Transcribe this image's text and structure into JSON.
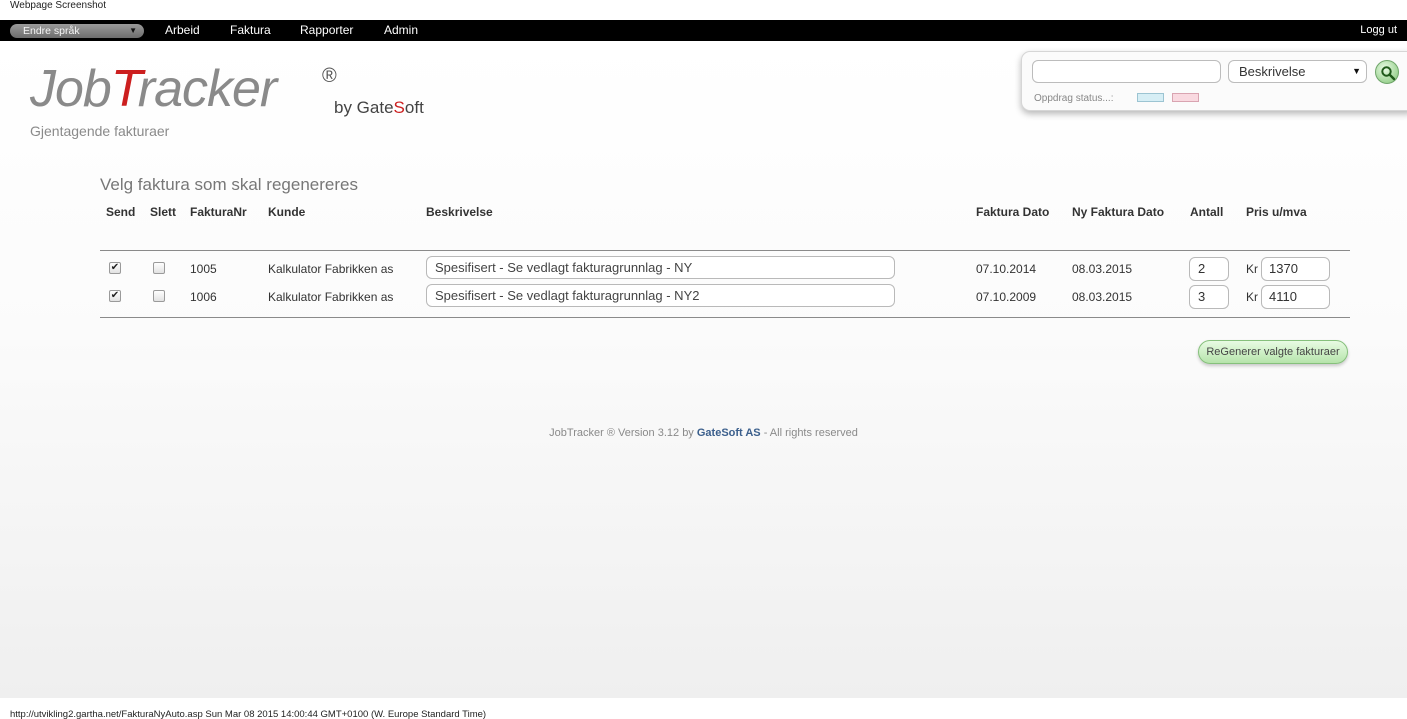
{
  "browser": {
    "caption_top": "Webpage Screenshot",
    "caption_bottom": "http://utvikling2.gartha.net/FakturaNyAuto.asp Sun Mar 08 2015 14:00:44 GMT+0100 (W. Europe Standard Time)"
  },
  "nav": {
    "language_select": "Endre språk",
    "items": [
      "Arbeid",
      "Faktura",
      "Rapporter",
      "Admin"
    ],
    "logout": "Logg ut"
  },
  "logo": {
    "job": "Job",
    "t": "T",
    "racker": "racker",
    "registered": "®",
    "by": "by Gate",
    "s": "S",
    "oft": "oft",
    "subtitle": "Gjentagende fakturaer"
  },
  "search": {
    "query_value": "",
    "field_select": "Beskrivelse",
    "status_label": "Oppdrag status...:",
    "status_colors": [
      "#d6eef5",
      "#f9d9e0"
    ]
  },
  "section": {
    "title": "Velg faktura som skal regenereres"
  },
  "table": {
    "headers": {
      "send": "Send",
      "slett": "Slett",
      "fakturanr": "FakturaNr",
      "kunde": "Kunde",
      "beskrivelse": "Beskrivelse",
      "faktura_dato": "Faktura Dato",
      "ny_faktura_dato": "Ny Faktura Dato",
      "antall": "Antall",
      "pris": "Pris u/mva"
    },
    "rows": [
      {
        "send_checked": true,
        "slett_checked": false,
        "fakturanr": "1005",
        "kunde": "Kalkulator Fabrikken as",
        "beskrivelse": "Spesifisert - Se vedlagt fakturagrunnlag - NY",
        "faktura_dato": "07.10.2014",
        "ny_faktura_dato": "08.03.2015",
        "antall": "2",
        "currency": "Kr",
        "pris": "1370"
      },
      {
        "send_checked": true,
        "slett_checked": false,
        "fakturanr": "1006",
        "kunde": "Kalkulator Fabrikken as",
        "beskrivelse": "Spesifisert - Se vedlagt fakturagrunnlag - NY2",
        "faktura_dato": "07.10.2009",
        "ny_faktura_dato": "08.03.2015",
        "antall": "3",
        "currency": "Kr",
        "pris": "4110"
      }
    ]
  },
  "actions": {
    "regenerate": "ReGenerer valgte fakturaer"
  },
  "footer": {
    "prefix": "JobTracker ® Version 3.12 by ",
    "brand": "GateSoft AS",
    "suffix": " - All rights reserved"
  }
}
